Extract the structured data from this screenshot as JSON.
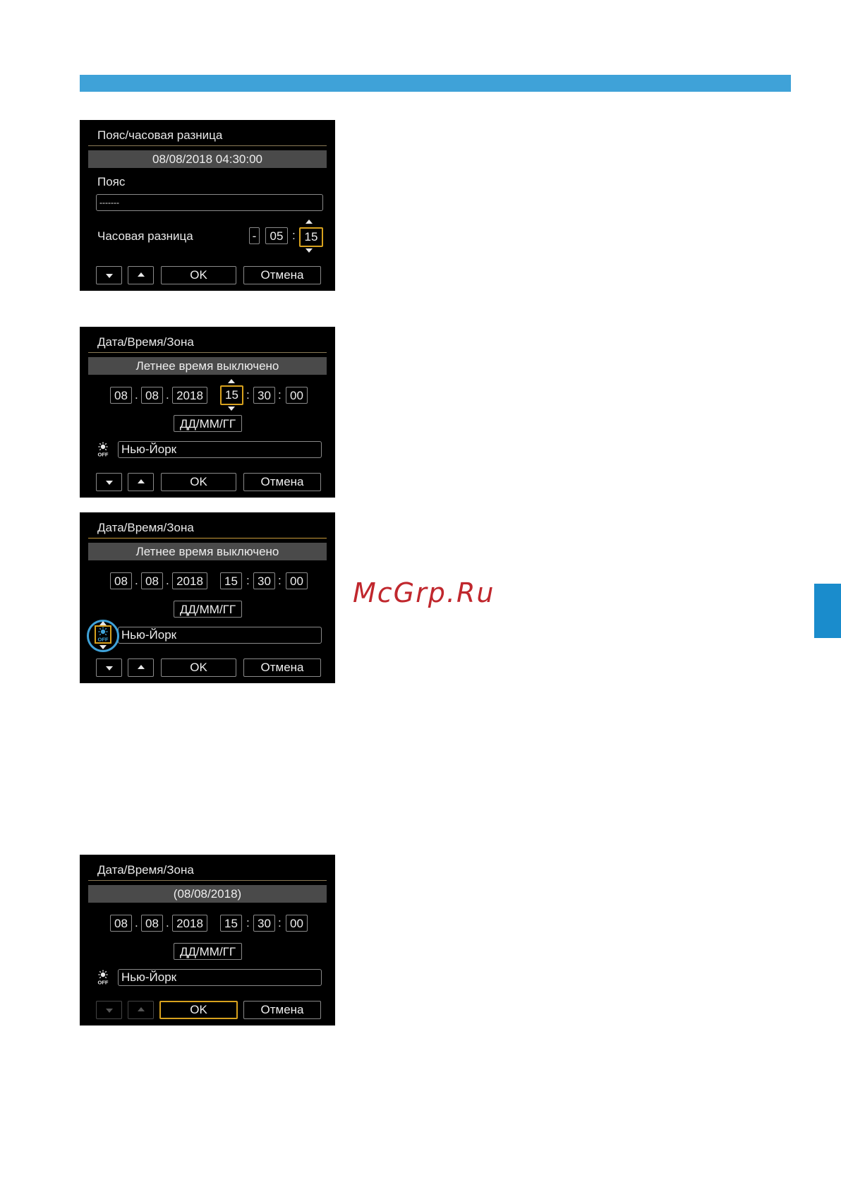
{
  "watermark": "McGrp.Ru",
  "screens": [
    {
      "title": "Пояс/часовая разница",
      "band": "08/08/2018 04:30:00",
      "zone_label": "Пояс",
      "zone_value": "-------",
      "offset_label": "Часовая разница",
      "offset": {
        "sign": "-",
        "hours": "05",
        "colon": ":",
        "minutes": "15"
      },
      "buttons": {
        "ok": "OK",
        "cancel": "Отмена"
      }
    },
    {
      "title": "Дата/Время/Зона",
      "band": "Летнее время выключено",
      "date": {
        "day": "08",
        "month": "08",
        "year": "2018",
        "dot": "."
      },
      "time": {
        "hour": "15",
        "minute": "30",
        "second": "00",
        "colon": ":"
      },
      "format": "ДД/ММ/ГГ",
      "city": "Нью-Йорк",
      "buttons": {
        "ok": "OK",
        "cancel": "Отмена"
      }
    },
    {
      "title": "Дата/Время/Зона",
      "band": "Летнее время выключено",
      "date": {
        "day": "08",
        "month": "08",
        "year": "2018",
        "dot": "."
      },
      "time": {
        "hour": "15",
        "minute": "30",
        "second": "00",
        "colon": ":"
      },
      "format": "ДД/ММ/ГГ",
      "city": "Нью-Йорк",
      "buttons": {
        "ok": "OK",
        "cancel": "Отмена"
      }
    },
    {
      "title": "Дата/Время/Зона",
      "band": "(08/08/2018)",
      "date": {
        "day": "08",
        "month": "08",
        "year": "2018",
        "dot": "."
      },
      "time": {
        "hour": "15",
        "minute": "30",
        "second": "00",
        "colon": ":"
      },
      "format": "ДД/ММ/ГГ",
      "city": "Нью-Йорк",
      "buttons": {
        "ok": "OK",
        "cancel": "Отмена"
      }
    }
  ],
  "colors": {
    "accent": "#3fa2d8",
    "select": "#d8a21e",
    "watermark": "#c0272d"
  }
}
